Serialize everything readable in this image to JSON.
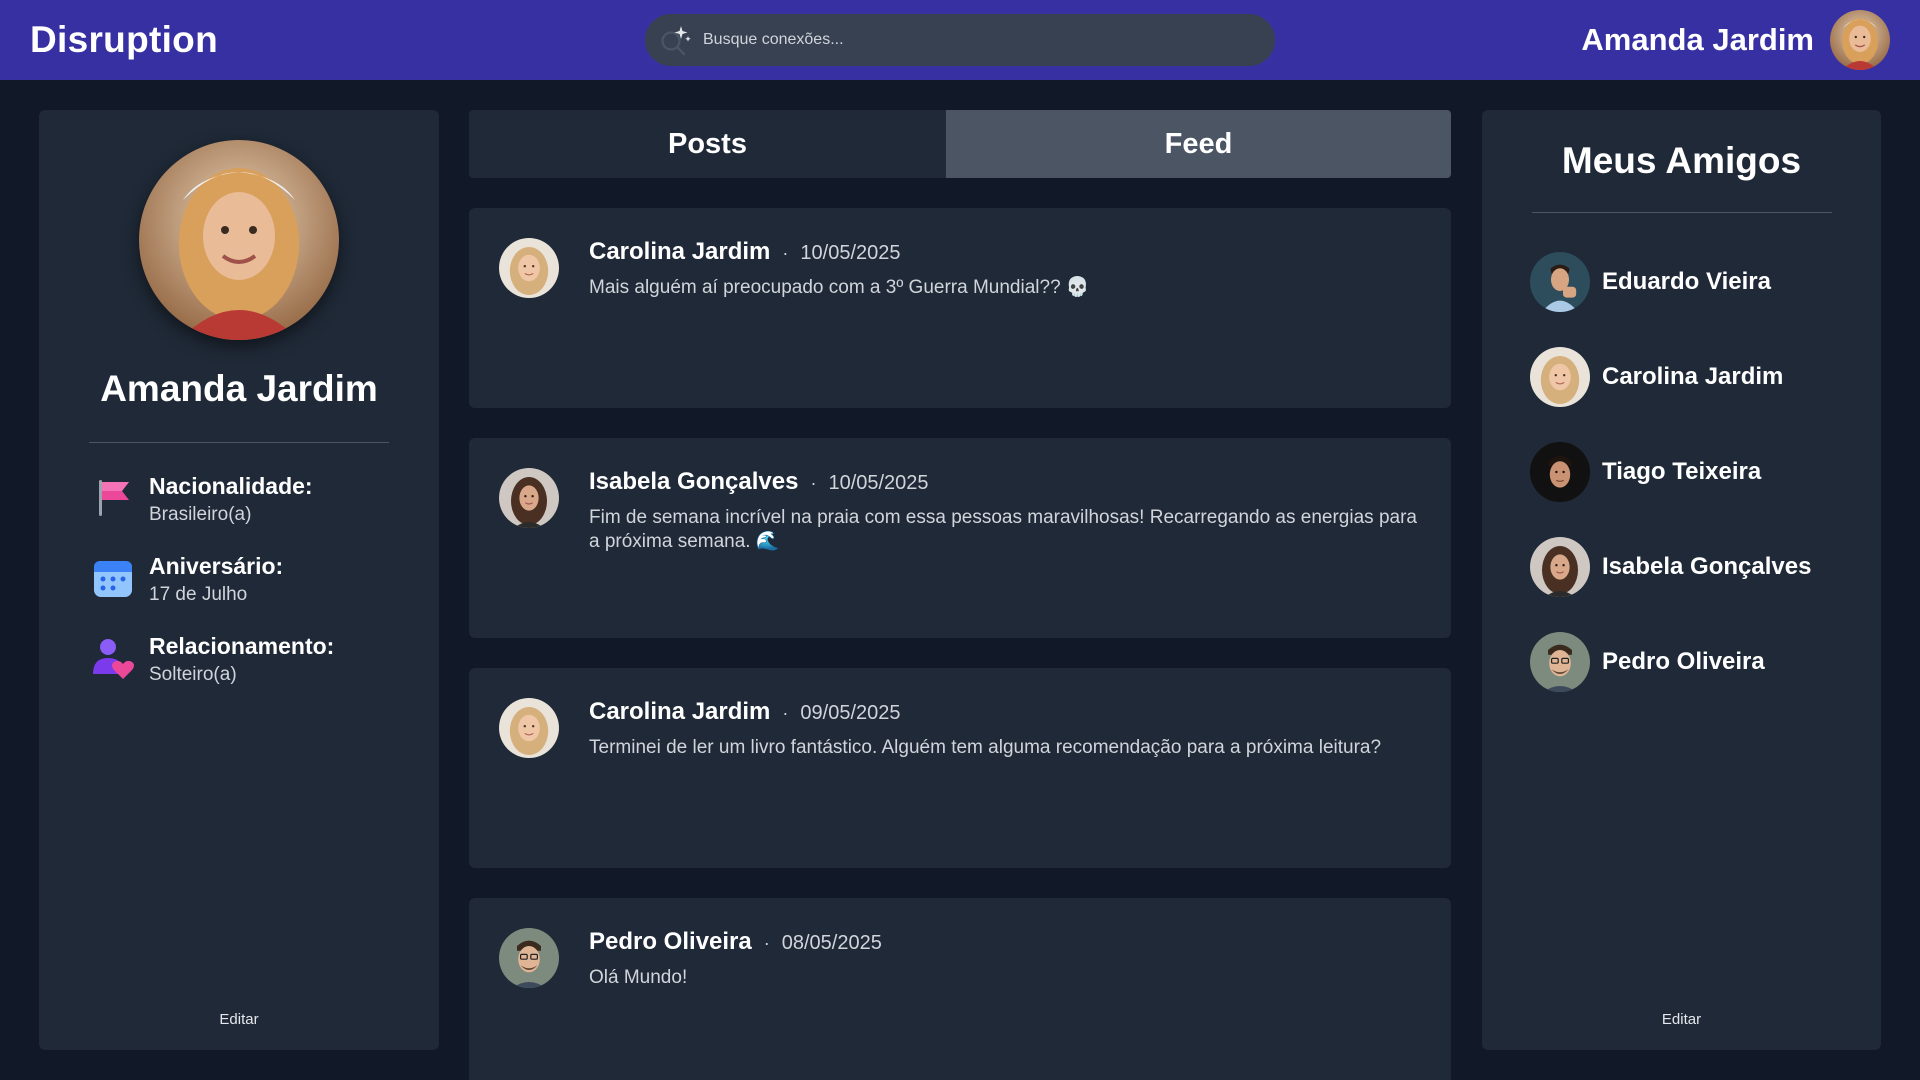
{
  "header": {
    "brand": "Disruption",
    "search_placeholder": "Busque conexões...",
    "user_name": "Amanda Jardim"
  },
  "profile": {
    "name": "Amanda Jardim",
    "info": [
      {
        "label": "Nacionalidade:",
        "value": "Brasileiro(a)",
        "icon": "flag-icon"
      },
      {
        "label": "Aniversário:",
        "value": "17 de Julho",
        "icon": "calendar-icon"
      },
      {
        "label": "Relacionamento:",
        "value": "Solteiro(a)",
        "icon": "relationship-icon"
      }
    ],
    "edit_label": "Editar"
  },
  "tabs": {
    "posts": "Posts",
    "feed": "Feed",
    "active": "feed"
  },
  "posts": [
    {
      "author": "Carolina Jardim",
      "date": "10/05/2025",
      "text": "Mais alguém aí preocupado com a 3º Guerra Mundial?? 💀"
    },
    {
      "author": "Isabela Gonçalves",
      "date": "10/05/2025",
      "text": "Fim de semana incrível na praia com essa pessoas maravilhosas! Recarregando as energias para a próxima semana. 🌊"
    },
    {
      "author": "Carolina Jardim",
      "date": "09/05/2025",
      "text": "Terminei de ler um livro fantástico. Alguém tem alguma recomendação para a próxima leitura?"
    },
    {
      "author": "Pedro Oliveira",
      "date": "08/05/2025",
      "text": "Olá Mundo!"
    }
  ],
  "friends": {
    "title": "Meus Amigos",
    "items": [
      {
        "name": "Eduardo Vieira"
      },
      {
        "name": "Carolina Jardim"
      },
      {
        "name": "Tiago Teixeira"
      },
      {
        "name": "Isabela Gonçalves"
      },
      {
        "name": "Pedro Oliveira"
      }
    ],
    "edit_label": "Editar"
  },
  "colors": {
    "header_bg": "#3730a3",
    "page_bg": "#111827",
    "panel_bg": "#1f2937",
    "active_tab_bg": "#4b5563",
    "search_bg": "#374151"
  }
}
